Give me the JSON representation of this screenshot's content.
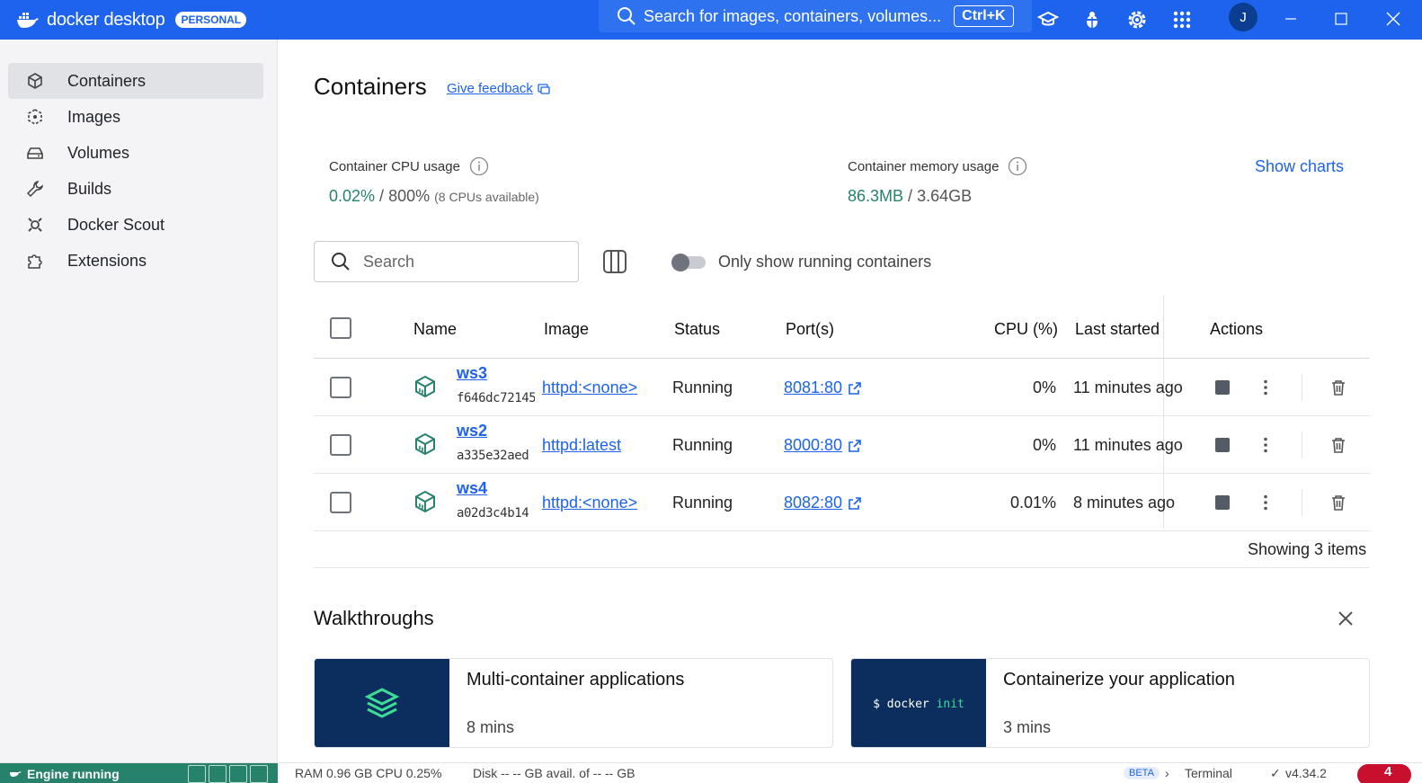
{
  "titlebar": {
    "brand_prefix": "docker",
    "brand_suffix": "desktop",
    "plan_badge": "PERSONAL",
    "search_placeholder": "Search for images, containers, volumes...",
    "search_shortcut": "Ctrl+K",
    "avatar_initial": "J",
    "icons": [
      "learning-center-icon",
      "troubleshoot-bug-icon",
      "settings-gear-icon",
      "apps-grid-icon"
    ]
  },
  "sidebar": {
    "items": [
      {
        "label": "Containers",
        "icon": "container-cube-icon",
        "active": true
      },
      {
        "label": "Images",
        "icon": "image-icon",
        "active": false
      },
      {
        "label": "Volumes",
        "icon": "volume-drive-icon",
        "active": false
      },
      {
        "label": "Builds",
        "icon": "wrench-icon",
        "active": false
      },
      {
        "label": "Docker Scout",
        "icon": "scout-icon",
        "active": false
      },
      {
        "label": "Extensions",
        "icon": "puzzle-icon",
        "active": false
      }
    ]
  },
  "main": {
    "title": "Containers",
    "feedback_label": "Give feedback",
    "cpu": {
      "label": "Container CPU usage",
      "used": "0.02%",
      "total": "800%",
      "note": "(8 CPUs available)"
    },
    "memory": {
      "label": "Container memory usage",
      "used": "86.3MB",
      "total": "3.64GB"
    },
    "show_charts_label": "Show charts",
    "search_placeholder": "Search",
    "toggle_label": "Only show running containers",
    "toggle_on": false,
    "columns": [
      "Name",
      "Image",
      "Status",
      "Port(s)",
      "CPU (%)",
      "Last started",
      "Actions"
    ],
    "rows": [
      {
        "name": "ws3",
        "id": "f646dc72145",
        "image": "httpd:<none>",
        "status": "Running",
        "ports": "8081:80",
        "cpu": "0%",
        "last_started": "11 minutes ago"
      },
      {
        "name": "ws2",
        "id": "a335e32aed",
        "image": "httpd:latest",
        "status": "Running",
        "ports": "8000:80",
        "cpu": "0%",
        "last_started": "11 minutes ago"
      },
      {
        "name": "ws4",
        "id": "a02d3c4b14",
        "image": "httpd:<none>",
        "status": "Running",
        "ports": "8082:80",
        "cpu": "0.01%",
        "last_started": "8 minutes ago"
      }
    ],
    "showing_text": "Showing 3 items",
    "walkthroughs": {
      "title": "Walkthroughs",
      "cards": [
        {
          "title": "Multi-container applications",
          "meta": "8 mins"
        },
        {
          "title": "Containerize your application",
          "meta": "3 mins",
          "code_prompt": "$ docker",
          "code_keyword": "init"
        }
      ]
    }
  },
  "footer": {
    "engine_status": "Engine running",
    "resources": "RAM 0.96 GB  CPU 0.25%",
    "disk": "Disk -- -- GB avail. of -- -- GB",
    "beta_badge": "BETA",
    "terminal_label": "Terminal",
    "version": "v4.34.2",
    "notifications": "4"
  },
  "colors": {
    "brand_blue": "#1d63ed",
    "engine_green": "#27826b",
    "thumb_navy": "#0b2e5f",
    "notif_red": "#c8102e"
  }
}
